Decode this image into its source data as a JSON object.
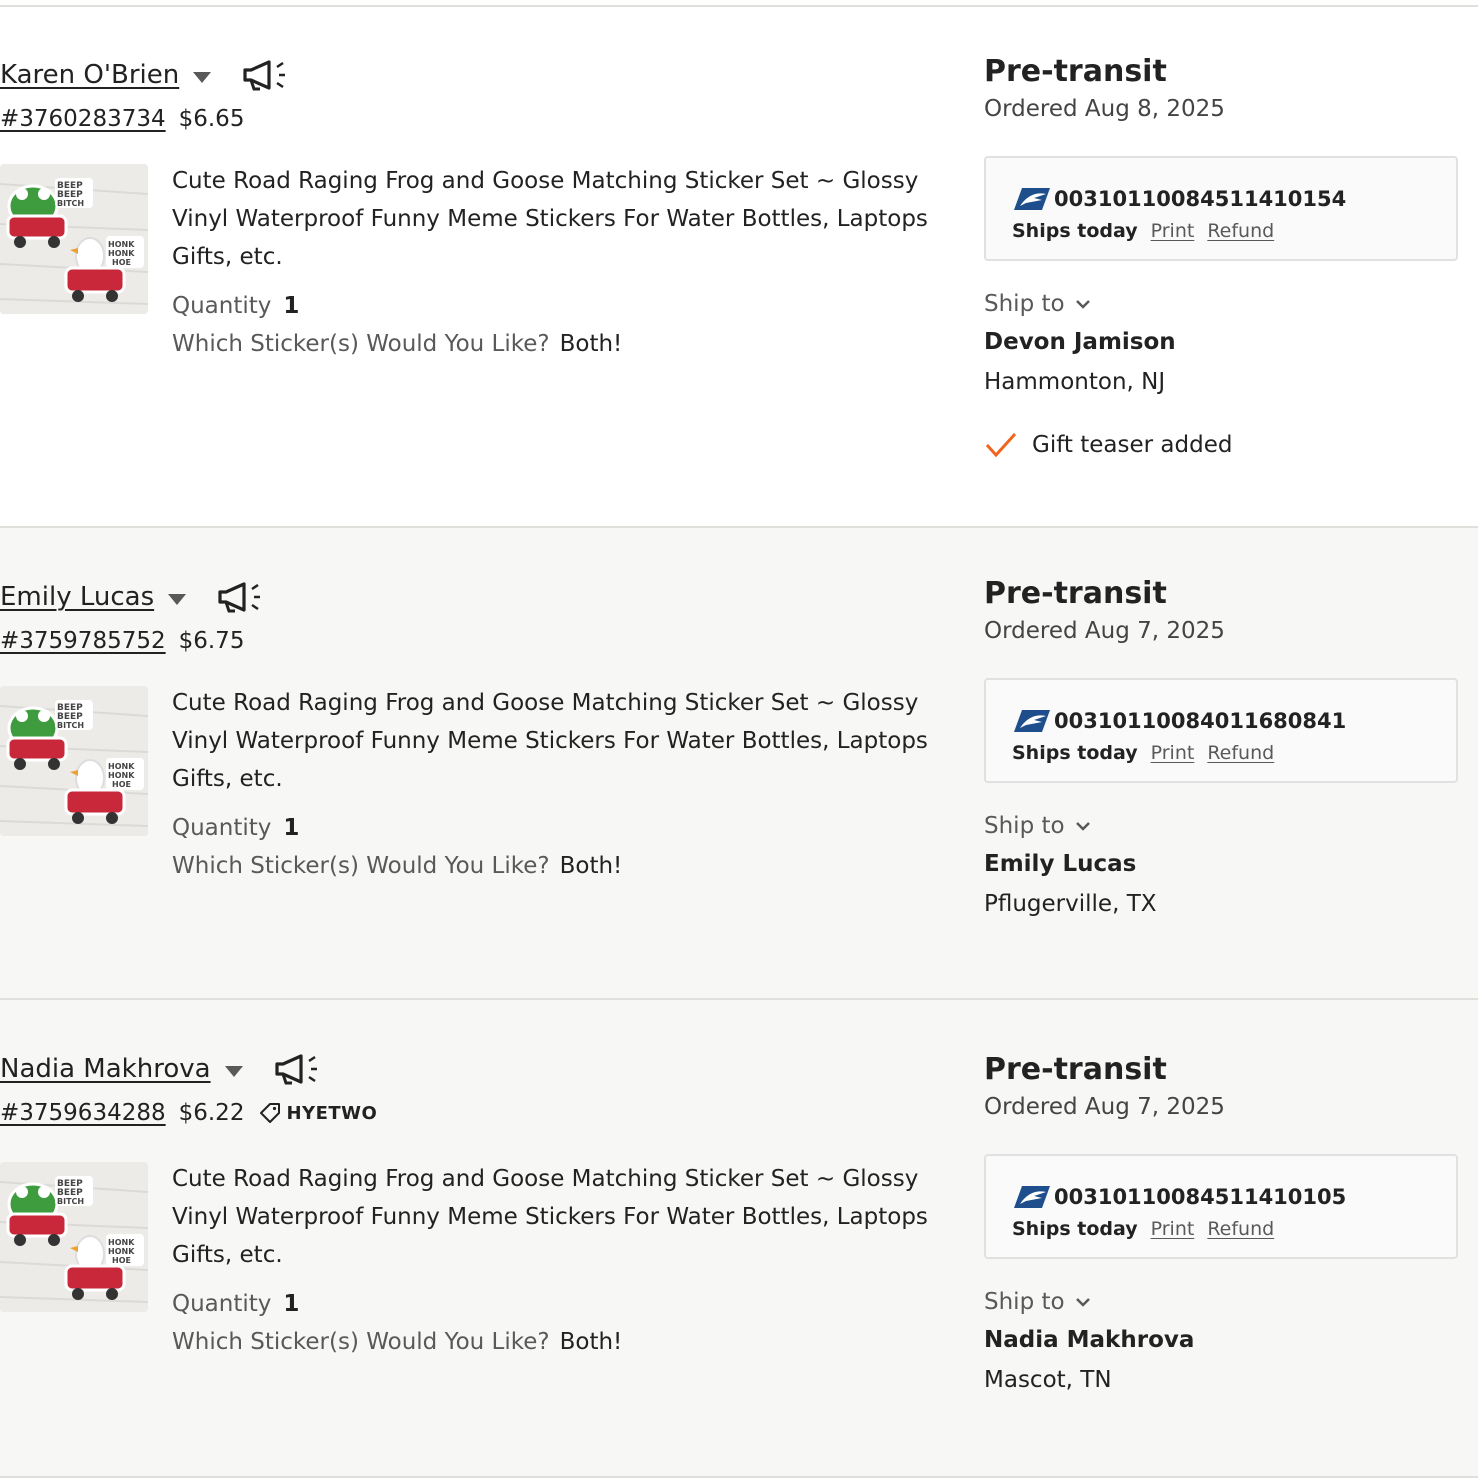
{
  "orders": [
    {
      "buyer": "Karen O'Brien",
      "order_id": "#3760283734",
      "price": "$6.65",
      "coupon": "",
      "item_title": "Cute Road Raging Frog and Goose Matching Sticker Set ~ Glossy Vinyl Waterproof Funny Meme Stickers For Water Bottles, Laptops Gifts, etc.",
      "quantity_label": "Quantity",
      "quantity": "1",
      "variation_label": "Which Sticker(s) Would You Like?",
      "variation_value": "Both!",
      "status": "Pre-transit",
      "ordered": "Ordered Aug 8, 2025",
      "tracking": "00310110084511410154",
      "ships": "Ships today",
      "print": "Print",
      "refund": "Refund",
      "ship_to_label": "Ship to",
      "recipient": "Devon Jamison",
      "city": "Hammonton, NJ",
      "gift": "Gift teaser added"
    },
    {
      "buyer": "Emily Lucas",
      "order_id": "#3759785752",
      "price": "$6.75",
      "coupon": "",
      "item_title": "Cute Road Raging Frog and Goose Matching Sticker Set ~ Glossy Vinyl Waterproof Funny Meme Stickers For Water Bottles, Laptops Gifts, etc.",
      "quantity_label": "Quantity",
      "quantity": "1",
      "variation_label": "Which Sticker(s) Would You Like?",
      "variation_value": "Both!",
      "status": "Pre-transit",
      "ordered": "Ordered Aug 7, 2025",
      "tracking": "00310110084011680841",
      "ships": "Ships today",
      "print": "Print",
      "refund": "Refund",
      "ship_to_label": "Ship to",
      "recipient": "Emily Lucas",
      "city": "Pflugerville, TX",
      "gift": ""
    },
    {
      "buyer": "Nadia Makhrova",
      "order_id": "#3759634288",
      "price": "$6.22",
      "coupon": "HYETWO",
      "item_title": "Cute Road Raging Frog and Goose Matching Sticker Set ~ Glossy Vinyl Waterproof Funny Meme Stickers For Water Bottles, Laptops Gifts, etc.",
      "quantity_label": "Quantity",
      "quantity": "1",
      "variation_label": "Which Sticker(s) Would You Like?",
      "variation_value": "Both!",
      "status": "Pre-transit",
      "ordered": "Ordered Aug 7, 2025",
      "tracking": "00310110084511410105",
      "ships": "Ships today",
      "print": "Print",
      "refund": "Refund",
      "ship_to_label": "Ship to",
      "recipient": "Nadia Makhrova",
      "city": "Mascot, TN",
      "gift": ""
    }
  ],
  "thumbnail": {
    "frog_text": "BEEP BEEP BITCH",
    "goose_text": "HONK HONK HOE"
  },
  "icons": {
    "caret": "caret-down-icon",
    "megaphone": "megaphone-icon",
    "coupon": "tag-icon",
    "carrier": "usps-eagle-icon",
    "chevron": "chevron-down-icon",
    "check": "checkmark-icon"
  },
  "colors": {
    "check": "#f1641e",
    "usps_blue": "#1f4e8c",
    "alt_row_bg": "#f7f7f5"
  }
}
